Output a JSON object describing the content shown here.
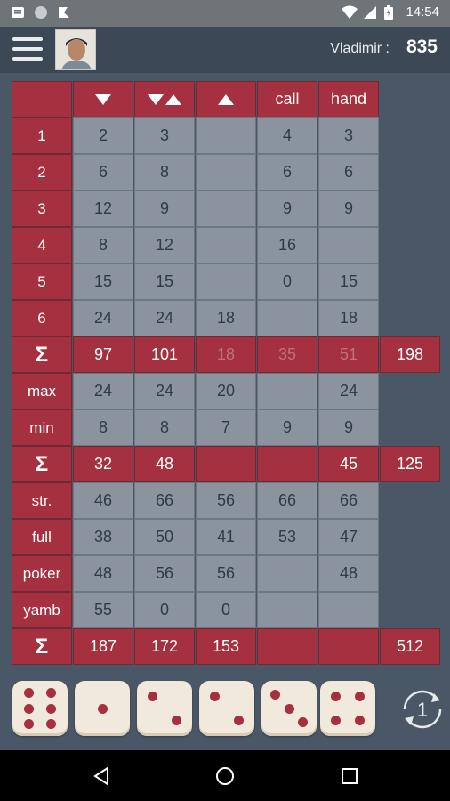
{
  "status": {
    "time": "14:54"
  },
  "player": {
    "name": "Vladimir :",
    "score": "835"
  },
  "columns": [
    {
      "key": "down",
      "label": "",
      "icon": "arrow-down-icon"
    },
    {
      "key": "updown",
      "label": "",
      "icon": "arrow-down-up-icon"
    },
    {
      "key": "up",
      "label": "",
      "icon": "arrow-up-icon"
    },
    {
      "key": "call",
      "label": "call"
    },
    {
      "key": "hand",
      "label": "hand"
    }
  ],
  "sections": {
    "numbers": {
      "rows": [
        {
          "label": "1",
          "values": [
            "2",
            "3",
            "",
            "4",
            "3"
          ]
        },
        {
          "label": "2",
          "values": [
            "6",
            "8",
            "",
            "6",
            "6"
          ]
        },
        {
          "label": "3",
          "values": [
            "12",
            "9",
            "",
            "9",
            "9"
          ]
        },
        {
          "label": "4",
          "values": [
            "8",
            "12",
            "",
            "16",
            ""
          ]
        },
        {
          "label": "5",
          "values": [
            "15",
            "15",
            "",
            "0",
            "15"
          ]
        },
        {
          "label": "6",
          "values": [
            "24",
            "24",
            "18",
            "",
            "18"
          ]
        }
      ],
      "sum": {
        "label": "Σ",
        "values": [
          "97",
          "101",
          "18",
          "35",
          "51"
        ],
        "faded": [
          false,
          false,
          true,
          true,
          true
        ],
        "total": "198"
      }
    },
    "maxmin": {
      "rows": [
        {
          "label": "max",
          "values": [
            "24",
            "24",
            "20",
            "",
            "24"
          ]
        },
        {
          "label": "min",
          "values": [
            "8",
            "8",
            "7",
            "9",
            "9"
          ]
        }
      ],
      "sum": {
        "label": "Σ",
        "values": [
          "32",
          "48",
          "",
          "",
          "45"
        ],
        "faded": [
          false,
          false,
          false,
          false,
          false
        ],
        "total": "125"
      }
    },
    "combos": {
      "rows": [
        {
          "label": "str.",
          "values": [
            "46",
            "66",
            "56",
            "66",
            "66"
          ]
        },
        {
          "label": "full",
          "values": [
            "38",
            "50",
            "41",
            "53",
            "47"
          ]
        },
        {
          "label": "poker",
          "values": [
            "48",
            "56",
            "56",
            "",
            "48"
          ]
        },
        {
          "label": "yamb",
          "values": [
            "55",
            "0",
            "0",
            "",
            ""
          ]
        }
      ],
      "sum": {
        "label": "Σ",
        "values": [
          "187",
          "172",
          "153",
          "",
          ""
        ],
        "faded": [
          false,
          false,
          false,
          false,
          false
        ],
        "total": "512"
      }
    }
  },
  "dice": [
    6,
    1,
    2,
    2,
    3,
    4
  ],
  "roll": {
    "count": "1"
  },
  "colors": {
    "accent": "#a5303f",
    "cell": "#8b949e",
    "background": "#4a5767"
  }
}
